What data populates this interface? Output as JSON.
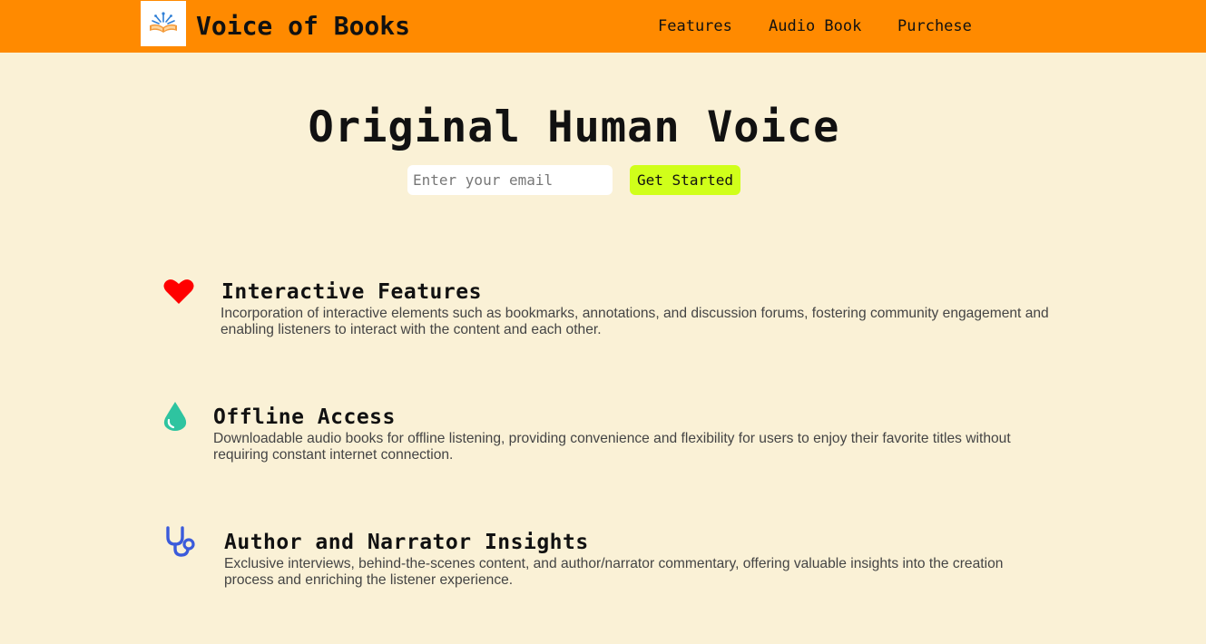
{
  "brand": {
    "name": "Voice of Books",
    "logo_icon": "open-book-logo-icon"
  },
  "nav": {
    "items": [
      {
        "label": "Features"
      },
      {
        "label": "Audio Book"
      },
      {
        "label": "Purchese"
      }
    ]
  },
  "hero": {
    "title": "Original Human Voice",
    "email_placeholder": "Enter your email",
    "email_value": "",
    "cta_label": "Get Started"
  },
  "features": [
    {
      "icon": "heart-icon",
      "title": "Interactive Features",
      "description": "Incorporation of interactive elements such as bookmarks, annotations, and discussion forums, fostering community engagement and enabling listeners to interact with the content and each other."
    },
    {
      "icon": "droplet-icon",
      "title": "Offline Access",
      "description": "Downloadable audio books for offline listening, providing convenience and flexibility for users to enjoy their favorite titles without requiring constant internet connection."
    },
    {
      "icon": "stethoscope-icon",
      "title": "Author and Narrator Insights",
      "description": "Exclusive interviews, behind-the-scenes content, and author/narrator commentary, offering valuable insights into the creation process and enriching the listener experience."
    }
  ],
  "colors": {
    "navbar": "#ff8a00",
    "background": "#faf1d6",
    "cta": "#d0ff1a",
    "heart": "#ff0000",
    "droplet": "#2ec4a0",
    "stethoscope": "#3b5bdb"
  }
}
